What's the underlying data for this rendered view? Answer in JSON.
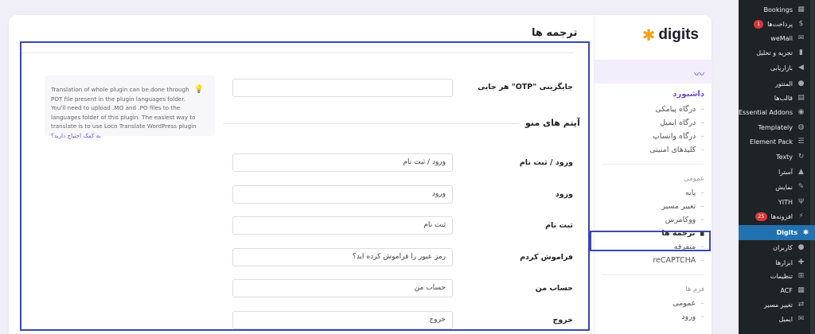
{
  "digits_nav": {
    "logo_text": "digits",
    "dashboard_heading": "داشبورد",
    "dashboard_items": [
      "درگاه پیامکی",
      "درگاه ایمیل",
      "درگاه واتساپ",
      "کلیدهای امنیتی"
    ],
    "general_heading": "عمومی",
    "general_items": [
      "پایه",
      "تغییر مسیر",
      "ووکامرس",
      "ترجمه ها",
      "متفرقه",
      "reCAPTCHA"
    ],
    "forms_heading": "فرم ها",
    "forms_items": [
      "عمومی",
      "ورود"
    ]
  },
  "main": {
    "section_title": "ترجمه ها",
    "otp_label": "جایگزینی \"OTP\" هر جایی",
    "otp_value": "",
    "menu_items_title": "آیتم های منو",
    "fields": [
      {
        "label": "ورود / ثبت نام",
        "value": "ورود / ثبت نام"
      },
      {
        "label": "ورود",
        "value": "ورود"
      },
      {
        "label": "ثبت نام",
        "value": "ثبت نام"
      },
      {
        "label": "فراموش کردم",
        "value": "رمز عبور را فراموش کرده اید؟"
      },
      {
        "label": "حساب من",
        "value": "حساب من"
      },
      {
        "label": "خروج",
        "value": "خروج"
      }
    ],
    "tip": {
      "text": "Translation of whole plugin can be done through POT file present in the plugin languages folder. You'll need to upload .MO and .PO files to the languages folder of this plugin. The easiest way to translate is to use Loco Translate WordPress plugin",
      "help_link": "به کمک احتیاج دارید؟"
    }
  },
  "wp_sidebar": {
    "items": [
      {
        "label": "Bookings",
        "icon": "calendar-icon"
      },
      {
        "label": "پرداخت‌ها",
        "icon": "dollar-icon",
        "badge": "1"
      },
      {
        "label": "weMail",
        "icon": "mail-icon"
      },
      {
        "label": "تجزیه و تحلیل",
        "icon": "chart-icon"
      },
      {
        "label": "بازاریابی",
        "icon": "megaphone-icon"
      },
      {
        "label": "المنتور",
        "icon": "elementor-icon"
      },
      {
        "label": "قالب‌ها",
        "icon": "templates-icon"
      },
      {
        "label": "Essential Addons",
        "icon": "ea-icon"
      },
      {
        "label": "Templately",
        "icon": "templately-icon"
      },
      {
        "label": "Element Pack",
        "icon": "element-pack-icon"
      },
      {
        "label": "Texty",
        "icon": "texty-icon"
      },
      {
        "label": "آسترا",
        "icon": "astra-icon"
      },
      {
        "label": "نمایش",
        "icon": "brush-icon"
      },
      {
        "label": "YITH",
        "icon": "yith-icon"
      },
      {
        "label": "افزونه‌ها",
        "icon": "plugin-icon",
        "badge": "25"
      },
      {
        "label": "Digits",
        "icon": "digits-star-icon",
        "active": true
      },
      {
        "label": "کاربران",
        "icon": "users-icon"
      },
      {
        "label": "ابزارها",
        "icon": "tools-icon"
      },
      {
        "label": "تنظیمات",
        "icon": "settings-icon"
      },
      {
        "label": "ACF",
        "icon": "acf-icon"
      },
      {
        "label": "تغییر مسیر",
        "icon": "redirect-icon"
      },
      {
        "label": "ایمیل",
        "icon": "email-icon"
      }
    ]
  }
}
